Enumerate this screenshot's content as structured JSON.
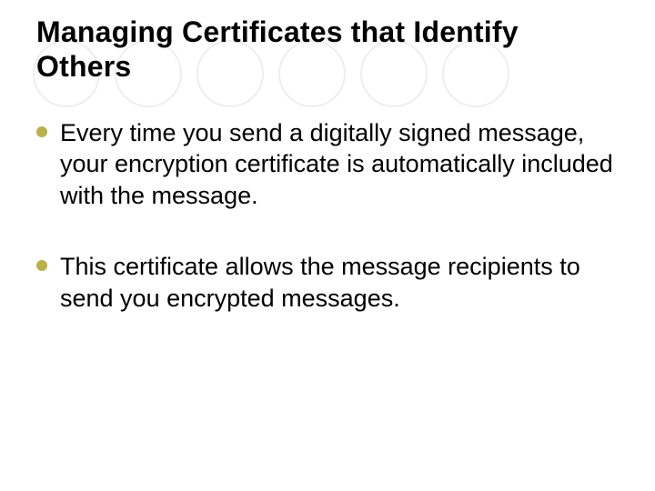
{
  "title": "Managing Certificates that Identify Others",
  "bullets": [
    "Every time you send a digitally signed message, your encryption certificate is automatically included with the message.",
    "This certificate allows the message recipients to send you encrypted messages."
  ],
  "decor": {
    "circle_count": 6
  }
}
